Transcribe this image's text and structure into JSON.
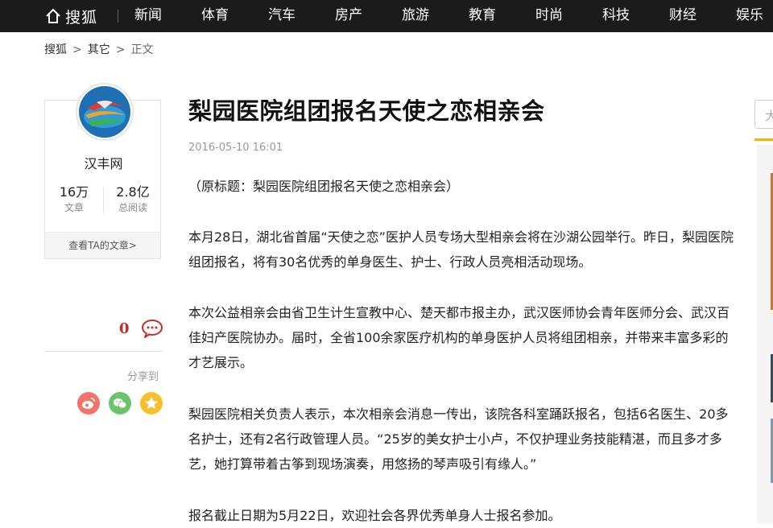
{
  "topbar": {
    "logo_text": "搜狐",
    "nav": [
      "新闻",
      "体育",
      "汽车",
      "房产",
      "旅游",
      "教育",
      "时尚",
      "科技",
      "财经",
      "娱乐"
    ]
  },
  "breadcrumb": [
    "搜狐",
    "其它",
    "正文"
  ],
  "author": {
    "name": "汉丰网",
    "articles_count": "16万",
    "articles_label": "文章",
    "reads_count": "2.8亿",
    "reads_label": "总阅读",
    "view_articles": "查看TA的文章>"
  },
  "comments": {
    "count": "0"
  },
  "share": {
    "label": "分享到"
  },
  "article": {
    "title": "梨园医院组团报名天使之恋相亲会",
    "date": "2016-05-10 16:01",
    "paragraphs": [
      "（原标题：梨园医院组团报名天使之恋相亲会）",
      "本月28日，湖北省首届“天使之恋”医护人员专场大型相亲会将在沙湖公园举行。昨日，梨园医院组团报名，将有30名优秀的单身医生、护士、行政人员亮相活动现场。",
      "本次公益相亲会由省卫生计生宣教中心、楚天都市报主办，武汉医师协会青年医师分会、武汉百佳妇产医院协办。届时，全省100余家医疗机构的单身医护人员将组团相亲，并带来丰富多彩的才艺展示。",
      "梨园医院相关负责人表示，本次相亲会消息一传出，该院各科室踊跃报名，包括6名医生、20多名护士，还有2名行政管理人员。“25岁的美女护士小卢，不仅护理业务技能精湛，而且多才多艺，她打算带着古筝到现场演奏，用悠扬的琴声吸引有缘人。”",
      "报名截止日期为5月22日，欢迎社会各界优秀单身人士报名参加。"
    ]
  },
  "sidebar_right": {
    "search_placeholder": "大"
  },
  "colors": {
    "topbar": "#1b1b1b",
    "accent": "#f5b400",
    "comment_red": "#c92a2a"
  }
}
